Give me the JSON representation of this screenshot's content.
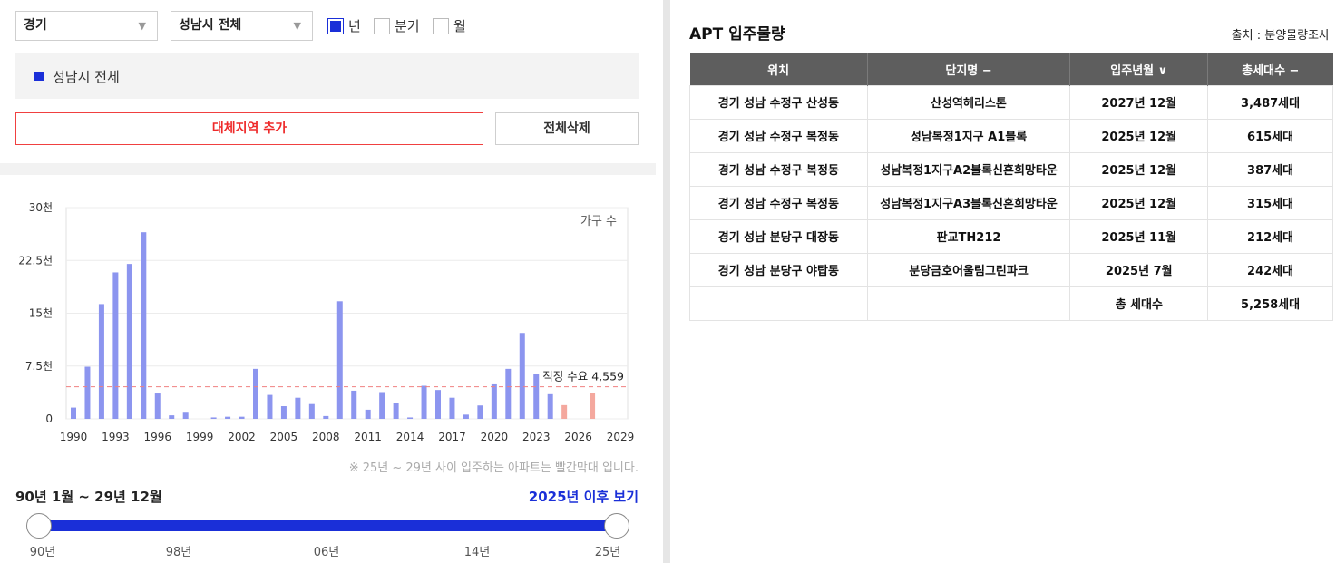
{
  "filters": {
    "province": "경기",
    "city": "성남시 전체",
    "period_options": [
      {
        "label": "년",
        "checked": true
      },
      {
        "label": "분기",
        "checked": false
      },
      {
        "label": "월",
        "checked": false
      }
    ]
  },
  "region_tag": "성남시 전체",
  "buttons": {
    "add_region": "대체지역 추가",
    "clear_all": "전체삭제"
  },
  "chart_data": {
    "type": "bar",
    "ylabel": "가구 수",
    "ylim": [
      0,
      30000
    ],
    "yticks": [
      {
        "value": 0,
        "label": "0"
      },
      {
        "value": 7500,
        "label": "7.5천"
      },
      {
        "value": 15000,
        "label": "15천"
      },
      {
        "value": 22500,
        "label": "22.5천"
      },
      {
        "value": 30000,
        "label": "30천"
      }
    ],
    "xlim": [
      1990,
      2029
    ],
    "xticks": [
      "1990",
      "1993",
      "1996",
      "1999",
      "2002",
      "2005",
      "2008",
      "2011",
      "2014",
      "2017",
      "2020",
      "2023",
      "2026",
      "2029"
    ],
    "x": [
      1990,
      1991,
      1992,
      1993,
      1994,
      1995,
      1996,
      1997,
      1998,
      1999,
      2000,
      2001,
      2002,
      2003,
      2004,
      2005,
      2006,
      2007,
      2008,
      2009,
      2010,
      2011,
      2012,
      2013,
      2014,
      2015,
      2016,
      2017,
      2018,
      2019,
      2020,
      2021,
      2022,
      2023,
      2024,
      2025,
      2026,
      2027,
      2028,
      2029
    ],
    "values": [
      1600,
      7400,
      16300,
      20800,
      22000,
      26500,
      3600,
      500,
      1000,
      0,
      200,
      300,
      300,
      7100,
      3400,
      1800,
      3000,
      2100,
      400,
      16700,
      4000,
      1300,
      3800,
      2300,
      200,
      4700,
      4100,
      3000,
      600,
      1900,
      4900,
      7100,
      12200,
      6400,
      3500,
      1950,
      0,
      3700,
      0,
      0
    ],
    "highlight_from": 2025,
    "bar_color": "#8c95ef",
    "highlight_color": "#f4a89e",
    "reference_line": {
      "value": 4559,
      "label": "적정 수요 4,559",
      "color": "#f08080"
    }
  },
  "note": "※ 25년 ~ 29년 사이 입주하는 아파트는 빨간막대 입니다.",
  "range": {
    "label": "90년 1월 ~ 29년 12월",
    "after_link": "2025년 이후 보기",
    "ticks": [
      "90년",
      "98년",
      "06년",
      "14년",
      "25년"
    ],
    "start": 0.0,
    "end": 1.0
  },
  "table": {
    "title": "APT 입주물량",
    "source": "출처 : 분양물량조사",
    "headers": [
      "위치",
      "단지명 −",
      "입주년월 ∨",
      "총세대수 −"
    ],
    "rows": [
      [
        "경기 성남 수정구 산성동",
        "산성역헤리스톤",
        "2027년 12월",
        "3,487세대"
      ],
      [
        "경기 성남 수정구 복정동",
        "성남복정1지구 A1블록",
        "2025년 12월",
        "615세대"
      ],
      [
        "경기 성남 수정구 복정동",
        "성남복정1지구A2블록신혼희망타운",
        "2025년 12월",
        "387세대"
      ],
      [
        "경기 성남 수정구 복정동",
        "성남복정1지구A3블록신혼희망타운",
        "2025년 12월",
        "315세대"
      ],
      [
        "경기 성남 분당구 대장동",
        "판교TH212",
        "2025년 11월",
        "212세대"
      ],
      [
        "경기 성남 분당구 야탑동",
        "분당금호어울림그린파크",
        "2025년 7월",
        "242세대"
      ]
    ],
    "total_label": "총 세대수",
    "total_value": "5,258세대"
  },
  "colors": {
    "accent": "#1a2fd8",
    "alert": "#ee2a2a",
    "header_bg": "#5e5e5e"
  }
}
